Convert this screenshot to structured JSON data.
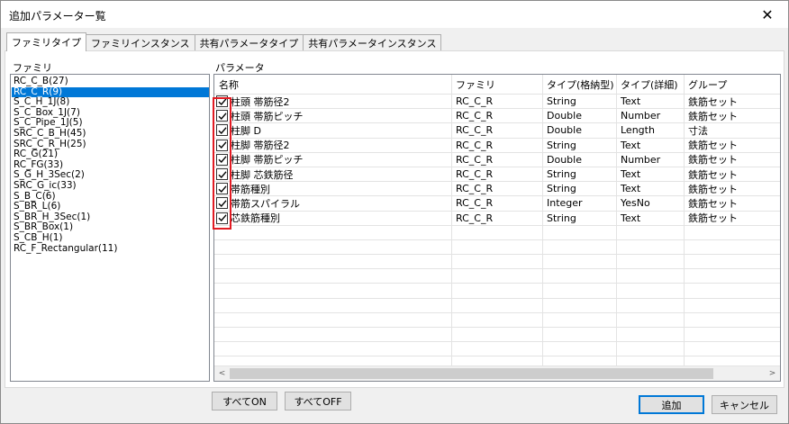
{
  "window": {
    "title": "追加パラメーター覧",
    "close_glyph": "✕"
  },
  "tabs": [
    "ファミリタイプ",
    "ファミリインスタンス",
    "共有パラメータタイプ",
    "共有パラメータインスタンス"
  ],
  "family_label": "ファミリ",
  "params_label": "パラメータ",
  "families": [
    "RC_C_B(27)",
    "RC_C_R(9)",
    "S_C_H_1J(8)",
    "S_C_Box_1J(7)",
    "S_C_Pipe_1J(5)",
    "SRC_C_B_H(45)",
    "SRC_C_R_H(25)",
    "RC_G(21)",
    "RC_FG(33)",
    "S_G_H_3Sec(2)",
    "SRC_G_ic(33)",
    "S_B_C(6)",
    "S_BR_L(6)",
    "S_BR_H_3Sec(1)",
    "S_BR_Box(1)",
    "S_CB_H(1)",
    "RC_F_Rectangular(11)"
  ],
  "selected_family": "RC_C_R(9)",
  "grid": {
    "headers": [
      "名称",
      "ファミリ",
      "タイプ(格納型)",
      "タイプ(詳細)",
      "グループ"
    ],
    "rows": [
      {
        "checked": true,
        "name": "柱頭 帯筋径2",
        "family": "RC_C_R",
        "storage": "String",
        "detail": "Text",
        "group": "鉄筋セット"
      },
      {
        "checked": true,
        "name": "柱頭 帯筋ピッチ",
        "family": "RC_C_R",
        "storage": "Double",
        "detail": "Number",
        "group": "鉄筋セット"
      },
      {
        "checked": true,
        "name": "柱脚 D",
        "family": "RC_C_R",
        "storage": "Double",
        "detail": "Length",
        "group": "寸法"
      },
      {
        "checked": true,
        "name": "柱脚 帯筋径2",
        "family": "RC_C_R",
        "storage": "String",
        "detail": "Text",
        "group": "鉄筋セット"
      },
      {
        "checked": true,
        "name": "柱脚 帯筋ピッチ",
        "family": "RC_C_R",
        "storage": "Double",
        "detail": "Number",
        "group": "鉄筋セット"
      },
      {
        "checked": true,
        "name": "柱脚 芯鉄筋径",
        "family": "RC_C_R",
        "storage": "String",
        "detail": "Text",
        "group": "鉄筋セット"
      },
      {
        "checked": true,
        "name": "帯筋種別",
        "family": "RC_C_R",
        "storage": "String",
        "detail": "Text",
        "group": "鉄筋セット"
      },
      {
        "checked": true,
        "name": "帯筋スパイラル",
        "family": "RC_C_R",
        "storage": "Integer",
        "detail": "YesNo",
        "group": "鉄筋セット"
      },
      {
        "checked": true,
        "name": "芯鉄筋種別",
        "family": "RC_C_R",
        "storage": "String",
        "detail": "Text",
        "group": "鉄筋セット"
      }
    ],
    "scroll_left_glyph": "<",
    "scroll_right_glyph": ">"
  },
  "buttons": {
    "all_on": "すべてON",
    "all_off": "すべてOFF",
    "add": "追加",
    "cancel": "キャンセル"
  },
  "colors": {
    "selection": "#0078d7",
    "highlight_box": "#e21b23"
  }
}
